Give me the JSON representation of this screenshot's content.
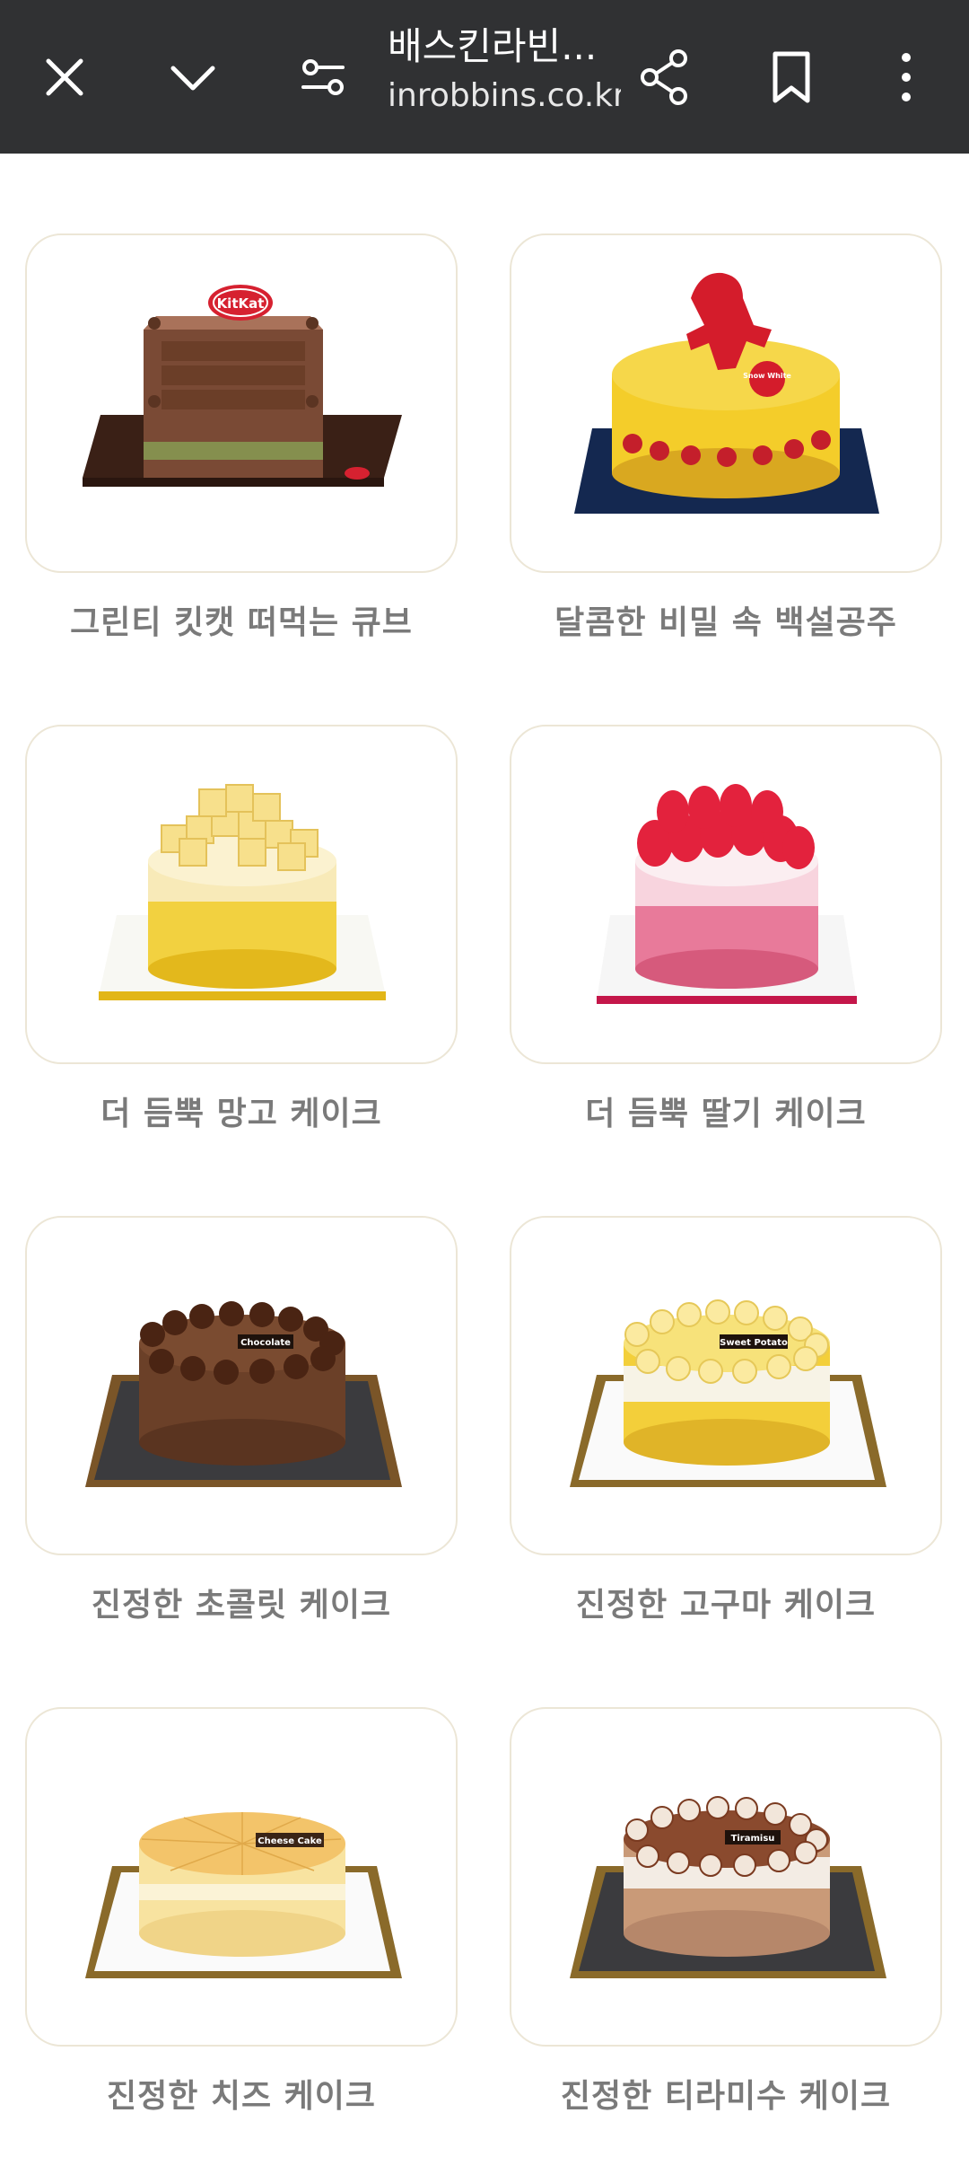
{
  "toolbar": {
    "title": "배스킨라빈...",
    "url": "inrobbins.co.kr",
    "icons": [
      "close-icon",
      "chevron-down-icon",
      "page-settings-icon",
      "share-icon",
      "bookmark-icon",
      "more-icon"
    ]
  },
  "products": [
    {
      "name": "그린티 킷캣 떠먹는 큐브",
      "cake_text": "KitKat"
    },
    {
      "name": "달콤한 비밀 속 백설공주",
      "cake_text": "Snow White"
    },
    {
      "name": "더 듬뿍 망고 케이크"
    },
    {
      "name": "더 듬뿍 딸기 케이크"
    },
    {
      "name": "진정한 초콜릿 케이크",
      "cake_text": "Chocolate"
    },
    {
      "name": "진정한 고구마 케이크",
      "cake_text": "Sweet Potato"
    },
    {
      "name": "진정한 치즈 케이크",
      "cake_text": "Cheese Cake"
    },
    {
      "name": "진정한 티라미수 케이크",
      "cake_text": "Tiramisu"
    }
  ],
  "colors": {
    "toolbar_bg": "#303133",
    "card_border": "#ece6d6",
    "caption": "#7a7a7a"
  }
}
